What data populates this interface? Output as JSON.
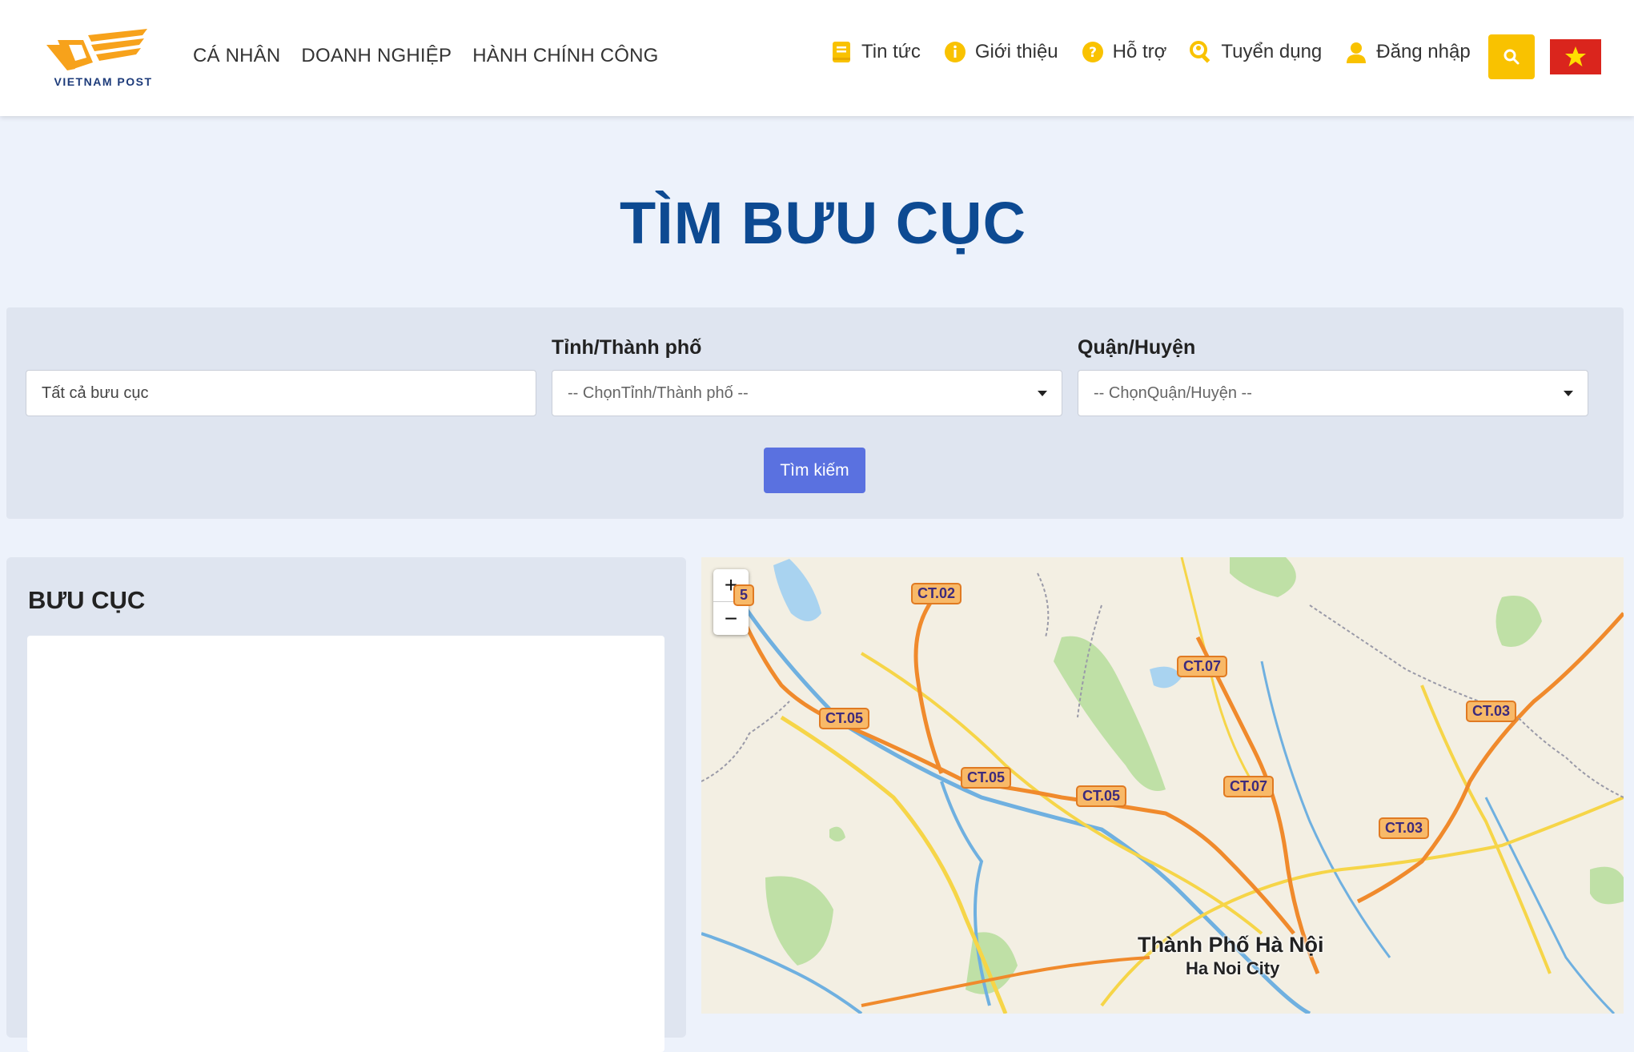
{
  "brand": {
    "logo_text": "VIETNAM POST",
    "color": "#f7a21b"
  },
  "mainnav": [
    {
      "label": "CÁ NHÂN"
    },
    {
      "label": "DOANH NGHIỆP"
    },
    {
      "label": "HÀNH CHÍNH CÔNG"
    }
  ],
  "topnav": [
    {
      "label": "Tin tức",
      "icon": "news-icon"
    },
    {
      "label": "Giới thiệu",
      "icon": "info-icon"
    },
    {
      "label": "Hỗ trợ",
      "icon": "help-icon"
    },
    {
      "label": "Tuyển dụng",
      "icon": "recruit-icon"
    },
    {
      "label": "Đăng nhập",
      "icon": "user-icon"
    }
  ],
  "page_title": "TÌM BƯU CỤC",
  "search": {
    "keyword_value": "Tất cả bưu cục",
    "province_label": "Tỉnh/Thành phố",
    "province_value": "-- ChọnTỉnh/Thành phố --",
    "district_label": "Quận/Huyện",
    "district_value": "-- ChọnQuận/Huyện --",
    "button_label": "Tìm kiếm"
  },
  "results": {
    "title": "BƯU CỤC"
  },
  "map": {
    "zoom_in": "+",
    "zoom_out": "−",
    "road_labels": [
      "5",
      "CT.02",
      "CT.07",
      "CT.05",
      "CT.03",
      "CT.05",
      "CT.05",
      "CT.07",
      "CT.03"
    ],
    "city_name": "Thành Phố Hà Nội",
    "city_name_en": "Ha Noi City"
  },
  "colors": {
    "accent": "#f9c200",
    "title": "#0d4a92",
    "button": "#5a71e0",
    "flag": "#da251d"
  }
}
